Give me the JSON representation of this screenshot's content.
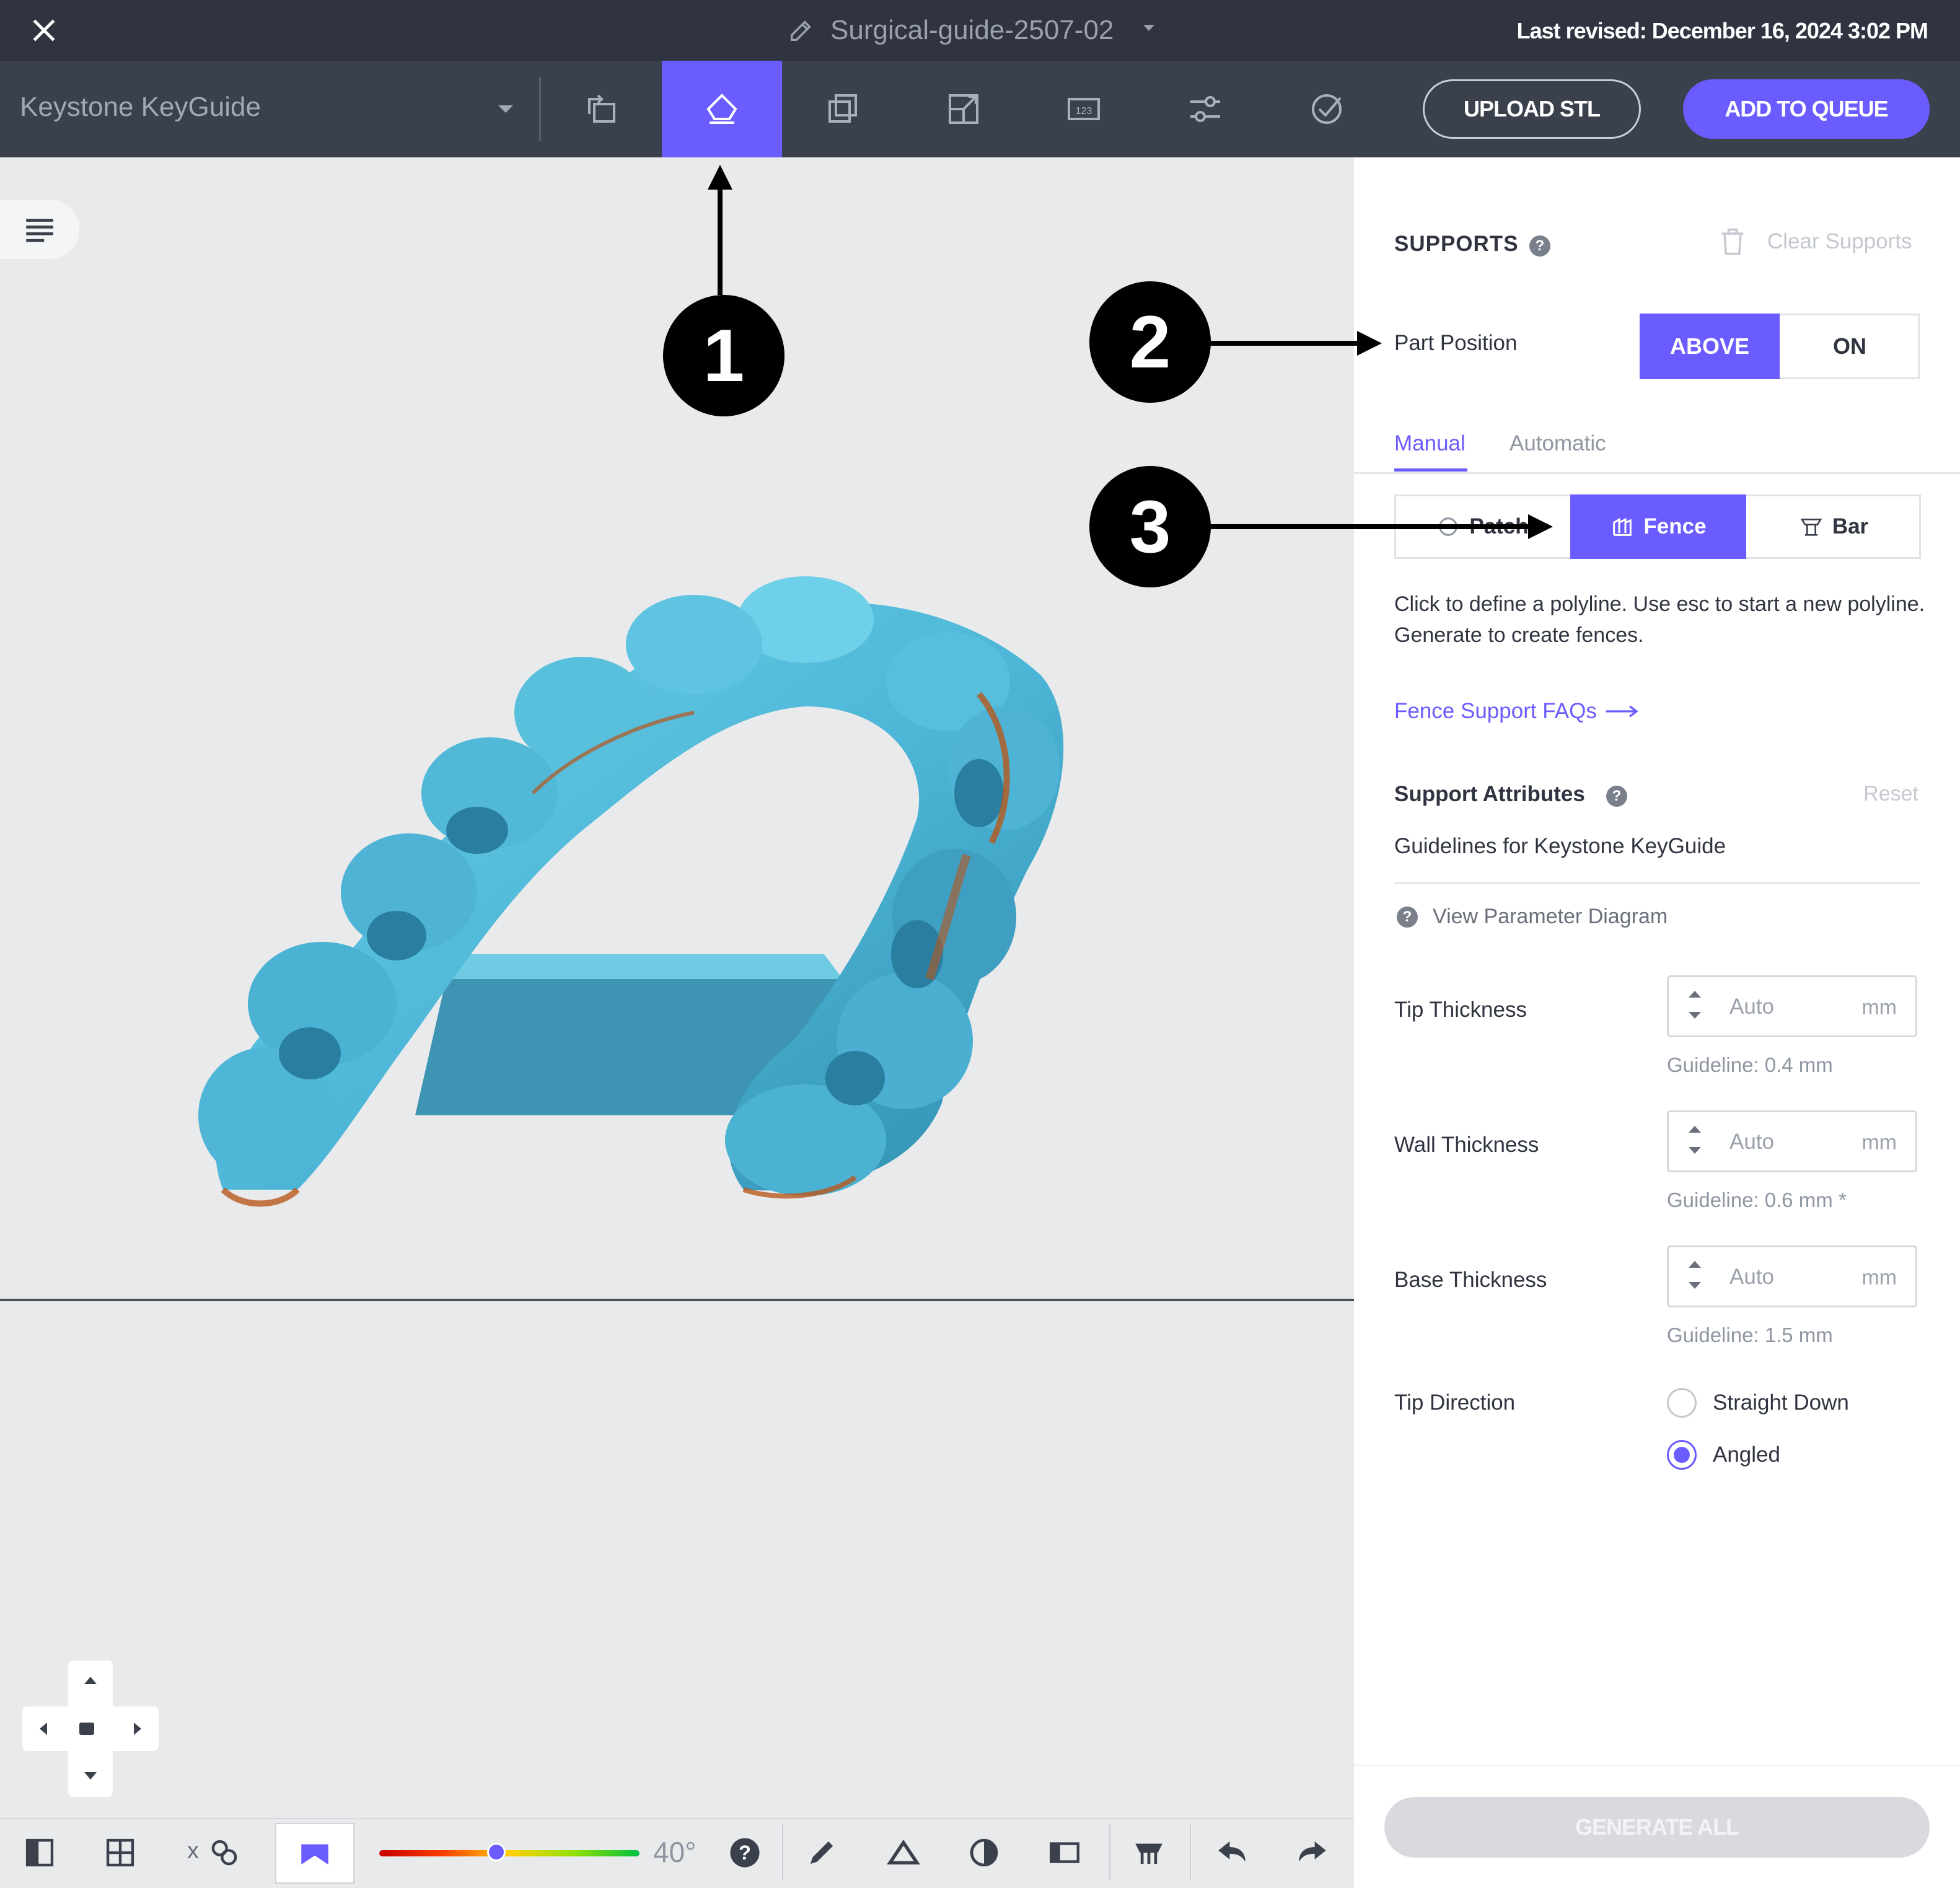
{
  "titlebar": {
    "file_name": "Surgical-guide-2507-02",
    "last_revised": "Last revised: December 16, 2024 3:02 PM"
  },
  "toolbar": {
    "printer": "Keystone KeyGuide",
    "upload_label": "UPLOAD STL",
    "queue_label": "ADD TO QUEUE",
    "tools": [
      "orientation-icon",
      "supports-icon",
      "duplicate-icon",
      "scale-icon",
      "label-icon",
      "adjust-icon",
      "check-icon"
    ],
    "active_tool": "supports-icon"
  },
  "panel": {
    "title": "SUPPORTS",
    "clear_supports": "Clear Supports",
    "part_position_label": "Part Position",
    "position_options": [
      "ABOVE",
      "ON"
    ],
    "position_selected": "ABOVE",
    "tabs": [
      "Manual",
      "Automatic"
    ],
    "tab_selected": "Manual",
    "support_types": [
      "Patch",
      "Fence",
      "Bar"
    ],
    "support_type_selected": "Fence",
    "instructions": "Click to define a polyline. Use esc to start a new polyline. Generate to create fences.",
    "faq_link": "Fence Support FAQs",
    "attributes_title": "Support Attributes",
    "reset_label": "Reset",
    "guidelines_text": "Guidelines for Keystone KeyGuide",
    "view_diagram": "View Parameter Diagram",
    "fields": [
      {
        "label": "Tip Thickness",
        "value": "Auto",
        "unit": "mm",
        "guideline": "Guideline: 0.4 mm"
      },
      {
        "label": "Wall Thickness",
        "value": "Auto",
        "unit": "mm",
        "guideline": "Guideline: 0.6 mm *"
      },
      {
        "label": "Base Thickness",
        "value": "Auto",
        "unit": "mm",
        "guideline": "Guideline: 1.5 mm"
      }
    ],
    "tip_direction_label": "Tip Direction",
    "tip_direction_options": [
      "Straight Down",
      "Angled"
    ],
    "tip_direction_selected": "Angled",
    "generate_all": "GENERATE ALL"
  },
  "bottombar": {
    "angle_value": "40°",
    "slider_fraction": 0.45,
    "axis_label": "x"
  },
  "callouts": [
    "1",
    "2",
    "3"
  ],
  "colors": {
    "accent": "#6b5cff",
    "model": "#5bc3e0",
    "toolbar": "#3a404c",
    "titlebar": "#2f3440"
  }
}
